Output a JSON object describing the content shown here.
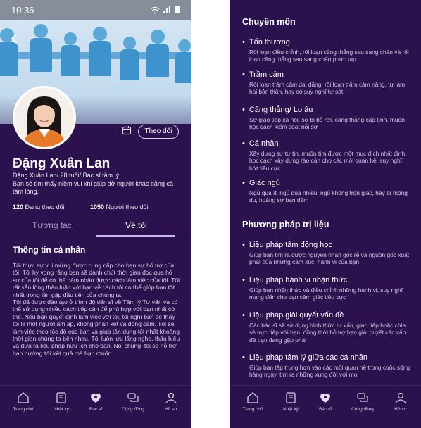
{
  "status": {
    "time": "10:36",
    "icons": "wifi-icon signal-icon battery-icon"
  },
  "profile": {
    "name": "Đặng Xuân Lan",
    "subtitle": "Đặng Xuân Lan/ 28 tuổi/ Bác sĩ tâm lý",
    "bio": "Bạn sẽ tìm thấy niềm vui khi giúp đỡ người khác bằng cả tấm lòng.",
    "following_count": "120",
    "following_label": "Đang theo dõi",
    "followers_count": "1050",
    "followers_label": "Người theo dõi",
    "follow_button": "Theo dõi"
  },
  "tabs": [
    {
      "label": "Tương tác",
      "active": false
    },
    {
      "label": "Về tôi",
      "active": true
    }
  ],
  "about": {
    "title": "Thông tin cá nhân",
    "paragraph1": "Tôi thực sự vui mừng được cung cấp cho bạn sự hỗ trợ của tôi. Tôi hy vọng rằng bạn sẽ dành chút thời gian đọc qua hồ sơ của tôi để có thể cảm nhận được cách làm việc của tôi. Tôi rất sẵn lòng thảo luận với bạn về cách tôi có thể giúp bạn tốt nhất trong lần gặp đầu tiên của chúng ta.",
    "paragraph2": "Tôi đã được đào tạo ở trình độ tiến sĩ về Tâm lý Tư vấn và có thể sử dụng nhiều cách tiếp cận để phù hợp với bạn nhất có thể. Nếu bạn quyết định làm việc với tôi, tôi nghĩ bạn sẽ thấy tôi là một người ấm áp, không phán xét và đồng cảm. Tôi sẽ làm việc theo tốc độ của bạn và giúp tận dụng tốt nhất khoảng thời gian chúng ta bên nhau. Tôi luôn lưu lắng nghe, thấu hiểu và đưa ra liệu pháp hữu ích cho bạn. Nói chung, tôi sẽ hỗ trợ bạn hướng tới kết quả mà bạn muốn."
  },
  "nav": [
    {
      "label": "Trang chủ",
      "icon": "home-icon"
    },
    {
      "label": "Nhật ký",
      "icon": "journal-icon"
    },
    {
      "label": "Bác sĩ",
      "icon": "doctor-icon",
      "active": true
    },
    {
      "label": "Cộng đồng",
      "icon": "community-icon"
    },
    {
      "label": "Hồ sơ",
      "icon": "profile-icon"
    }
  ],
  "specialties": {
    "title": "Chuyên môn",
    "items": [
      {
        "title": "Tổn thương",
        "desc": "Rối loạn điều chỉnh, rối loạn căng thẳng sau sang chấn và rối loạn căng thẳng sau sang chấn phức tạp"
      },
      {
        "title": "Trầm cảm",
        "desc": "Rối loạn trầm cảm dai dẳng, rối loạn trầm cảm nặng, tự làm hại bản thân, hay có suy nghĩ tự sát"
      },
      {
        "title": "Căng thẳng/ Lo âu",
        "desc": "Sợ giao tiếp xã hội, sợ bị bỏ rơi, căng thẳng cấp tính, muốn học cách kiểm soát nỗi sợ"
      },
      {
        "title": "Cá nhân",
        "desc": "Xây dựng sự tự tin, muốn tìm được một mục đích nhất định, học cách xây dựng rào cản cho các mối quan hệ, suy nghĩ bớt tiêu cực"
      },
      {
        "title": "Giấc ngủ",
        "desc": "Ngủ quá ít, ngủ quá nhiều, ngủ không trọn giấc, hay bị mộng du, hoảng sợ ban đêm"
      }
    ]
  },
  "methods": {
    "title": "Phương pháp trị liệu",
    "items": [
      {
        "title": "Liệu pháp tâm động học",
        "desc": "Giúp bạn tìm ra được nguyên nhân gốc rễ và nguồn gốc xuất phát của những cảm xúc, hành vi của bạn"
      },
      {
        "title": "Liệu pháp hành vi nhận thức",
        "desc": "Giúp bạn nhận thức và điều chỉnh những hành vi, suy nghĩ mang đến cho bạn cảm giác tiêu cực"
      },
      {
        "title": "Liệu pháp giải quyết vấn đề",
        "desc": "Các bác sĩ sẽ sử dụng hình thức tư vấn, giao tiếp hoặc chia sẻ trực tiếp với bạn, đồng thời hỗ trợ bạn giải quyết các vấn đề bạn đang gặp phải"
      },
      {
        "title": "Liệu pháp tâm lý giữa các cá nhân",
        "desc": "Giúp bạn tập trung hơn vào các mối quan hệ trong cuộc sống hàng ngày, tìm ra những xung đột với mọi"
      }
    ]
  },
  "colors": {
    "background": "#2b124e",
    "accent": "#c9b6f0",
    "text_muted": "#cfc6e0"
  }
}
